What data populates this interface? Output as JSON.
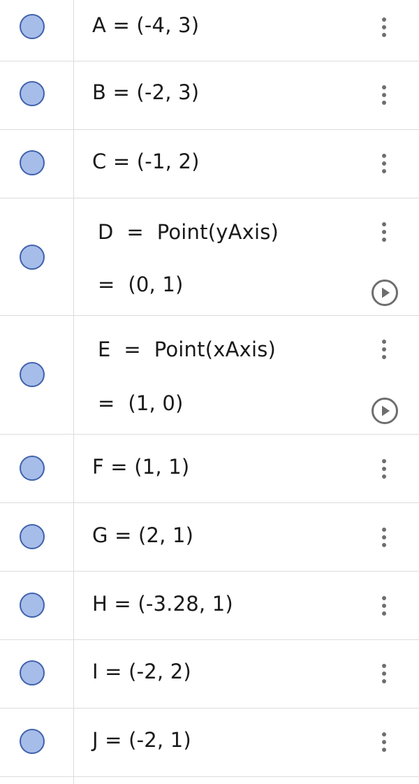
{
  "colors": {
    "point_fill": "#a7bde9",
    "point_stroke": "#3f61ad",
    "divider": "#dcdcdc",
    "icon": "#6e6e6e"
  },
  "icons": {
    "visibility": "circle-point-icon",
    "menu": "more-vertical-icon",
    "animate": "play-circle-icon"
  },
  "items": [
    {
      "text": "A = (-4, 3)"
    },
    {
      "text": "B = (-2, 3)"
    },
    {
      "text": "C = (-1, 2)"
    },
    {
      "definition": "D  =  Point(yAxis)",
      "value": "=  (0, 1)"
    },
    {
      "definition": "E  =  Point(xAxis)",
      "value": "=  (1, 0)"
    },
    {
      "text": "F = (1, 1)"
    },
    {
      "text": "G = (2, 1)"
    },
    {
      "text": "H = (-3.28, 1)"
    },
    {
      "text": "I = (-2, 2)"
    },
    {
      "text": "J = (-2, 1)"
    }
  ]
}
